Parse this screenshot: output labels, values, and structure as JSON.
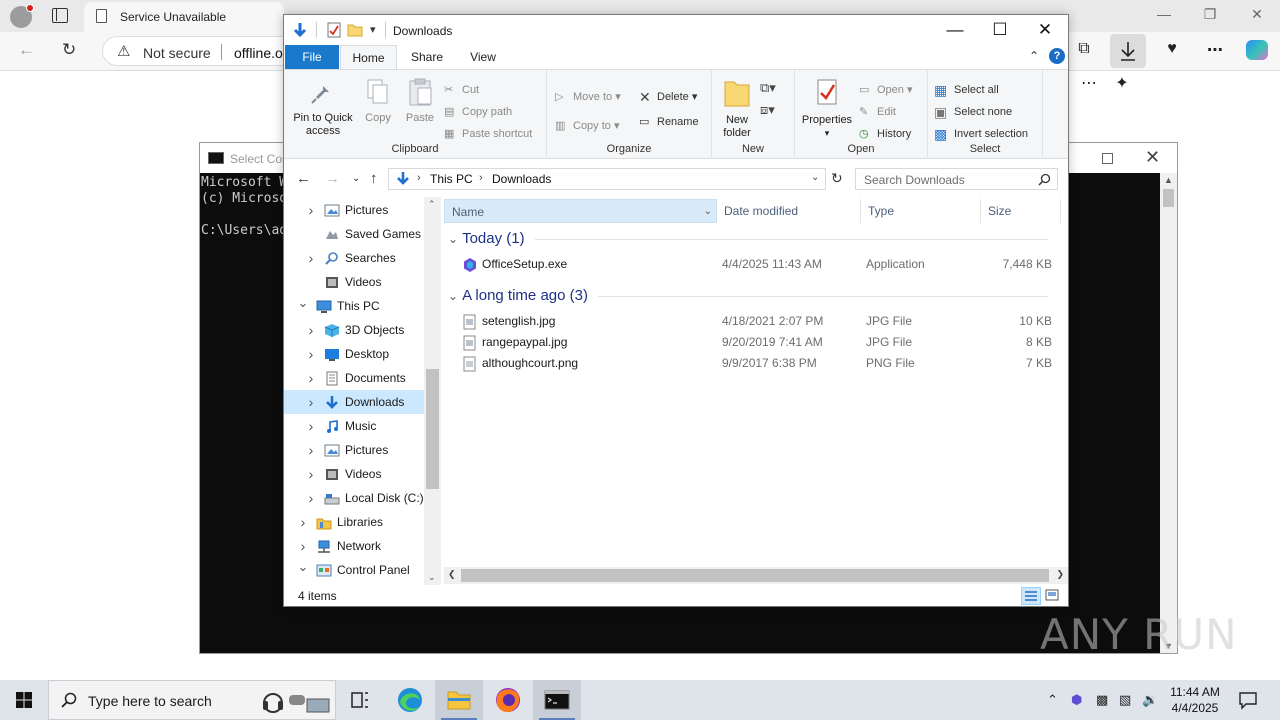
{
  "browser": {
    "tab_title": "Service Unavailable",
    "security_label": "Not secure",
    "url_fragment": "offline.of"
  },
  "cmd": {
    "title": "Select Cor",
    "lines": [
      "Microsoft W",
      "(c) Microso",
      "",
      "C:\\Users\\ad"
    ]
  },
  "explorer": {
    "window_title": "Downloads",
    "tabs": {
      "file": "File",
      "home": "Home",
      "share": "Share",
      "view": "View"
    },
    "ribbon": {
      "clipboard": {
        "label": "Clipboard",
        "pin": "Pin to Quick access",
        "pin_line1": "Pin to Quick",
        "pin_line2": "access",
        "copy": "Copy",
        "paste": "Paste",
        "cut": "Cut",
        "copy_path": "Copy path",
        "paste_shortcut": "Paste shortcut"
      },
      "organize": {
        "label": "Organize",
        "move_to": "Move to",
        "copy_to": "Copy to",
        "delete": "Delete",
        "rename": "Rename"
      },
      "new": {
        "label": "New",
        "new_folder_line1": "New",
        "new_folder_line2": "folder"
      },
      "open": {
        "label": "Open",
        "properties": "Properties",
        "open": "Open",
        "edit": "Edit",
        "history": "History"
      },
      "select": {
        "label": "Select",
        "select_all": "Select all",
        "select_none": "Select none",
        "invert": "Invert selection"
      }
    },
    "address": {
      "crumbs": [
        "This PC",
        "Downloads"
      ]
    },
    "search_placeholder": "Search Downloads",
    "tree": [
      {
        "label": "Pictures",
        "level": 1,
        "expand": true,
        "icon": "pictures-icon"
      },
      {
        "label": "Saved Games",
        "level": 1,
        "expand": false,
        "icon": "saved-games-icon"
      },
      {
        "label": "Searches",
        "level": 1,
        "expand": true,
        "icon": "searches-icon"
      },
      {
        "label": "Videos",
        "level": 1,
        "expand": false,
        "icon": "videos-icon"
      },
      {
        "label": "This PC",
        "level": 0,
        "expand": "open",
        "icon": "this-pc-icon"
      },
      {
        "label": "3D Objects",
        "level": 1,
        "expand": true,
        "icon": "3d-objects-icon"
      },
      {
        "label": "Desktop",
        "level": 1,
        "expand": true,
        "icon": "desktop-icon"
      },
      {
        "label": "Documents",
        "level": 1,
        "expand": true,
        "icon": "documents-icon"
      },
      {
        "label": "Downloads",
        "level": 1,
        "expand": true,
        "icon": "downloads-icon",
        "selected": true
      },
      {
        "label": "Music",
        "level": 1,
        "expand": true,
        "icon": "music-icon"
      },
      {
        "label": "Pictures",
        "level": 1,
        "expand": true,
        "icon": "pictures-icon"
      },
      {
        "label": "Videos",
        "level": 1,
        "expand": true,
        "icon": "videos-icon"
      },
      {
        "label": "Local Disk (C:)",
        "level": 1,
        "expand": true,
        "icon": "local-disk-icon"
      },
      {
        "label": "Libraries",
        "level": 0,
        "expand": true,
        "icon": "libraries-icon"
      },
      {
        "label": "Network",
        "level": 0,
        "expand": true,
        "icon": "network-icon"
      },
      {
        "label": "Control Panel",
        "level": 0,
        "expand": "open",
        "icon": "control-panel-icon"
      }
    ],
    "columns": {
      "name": "Name",
      "date": "Date modified",
      "type": "Type",
      "size": "Size"
    },
    "groups": [
      {
        "title": "Today (1)",
        "files": [
          {
            "name": "OfficeSetup.exe",
            "date": "4/4/2025 11:43 AM",
            "type": "Application",
            "size": "7,448 KB",
            "icon": "office-setup-icon"
          }
        ]
      },
      {
        "title": "A long time ago (3)",
        "files": [
          {
            "name": "setenglish.jpg",
            "date": "4/18/2021 2:07 PM",
            "type": "JPG File",
            "size": "10 KB",
            "icon": "jpg-file-icon"
          },
          {
            "name": "rangepaypal.jpg",
            "date": "9/20/2019 7:41 AM",
            "type": "JPG File",
            "size": "8 KB",
            "icon": "jpg-file-icon"
          },
          {
            "name": "althoughcourt.png",
            "date": "9/9/2017 6:38 PM",
            "type": "PNG File",
            "size": "7 KB",
            "icon": "png-file-icon"
          }
        ]
      }
    ],
    "status": "4 items"
  },
  "taskbar": {
    "search_placeholder": "Type here to search",
    "time": "11:44 AM",
    "date": "4/4/2025"
  },
  "watermark": "ANY RUN",
  "colors": {
    "accent": "#1979ca",
    "selection": "#cce8ff",
    "group_header": "#1e3287"
  }
}
